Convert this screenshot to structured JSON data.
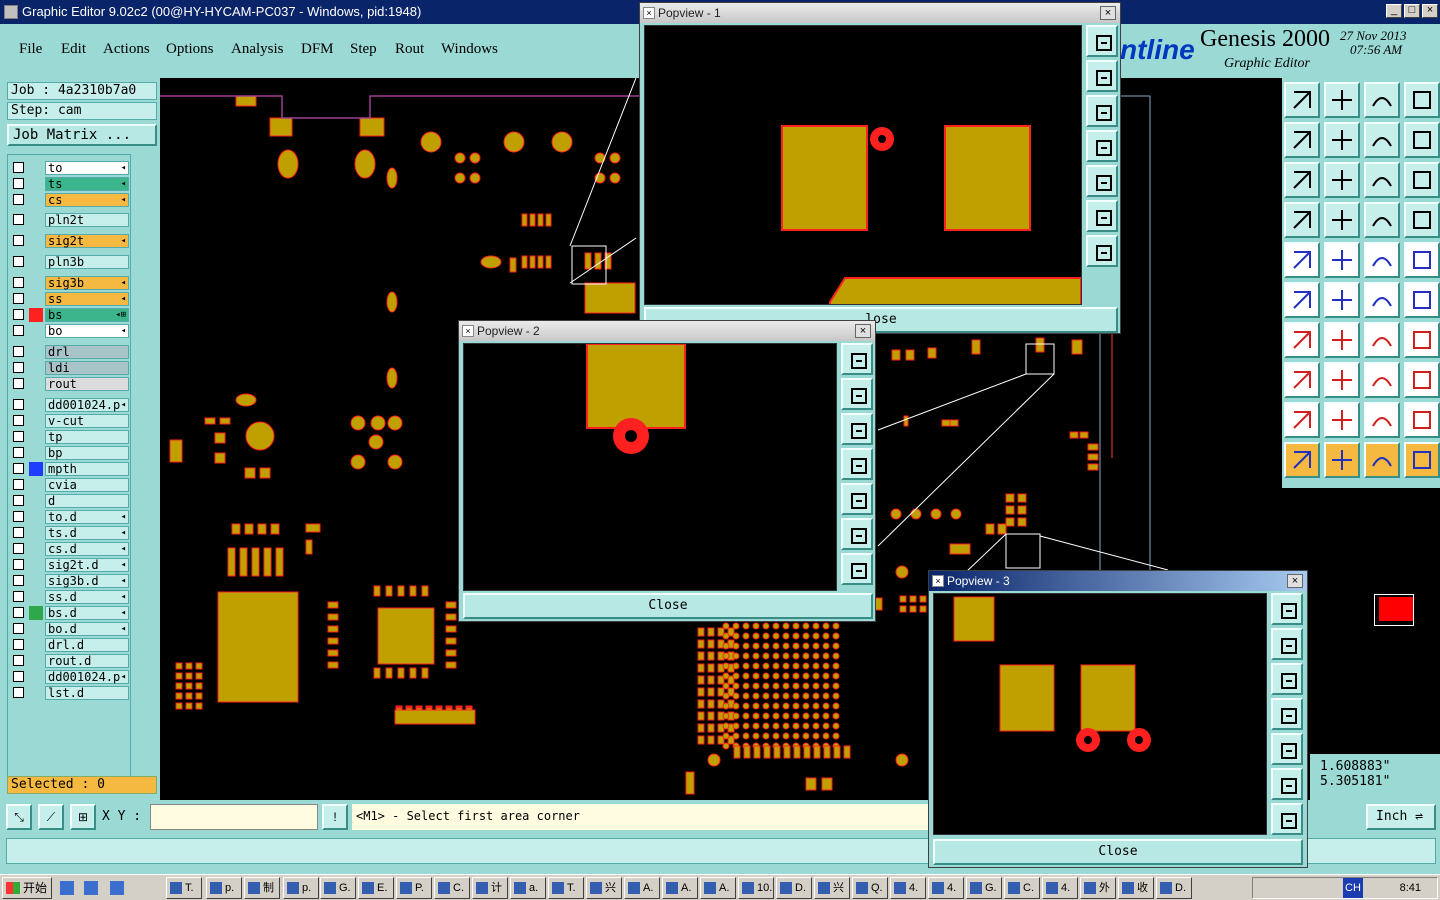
{
  "window": {
    "title": "Graphic Editor 9.02c2 (00@HY-HYCAM-PC037 - Windows, pid:1948)"
  },
  "menu": [
    "File",
    "Edit",
    "Actions",
    "Options",
    "Analysis",
    "DFM",
    "Step",
    "Rout",
    "Windows"
  ],
  "brand": {
    "frontline": "ntline",
    "product": "Genesis 2000",
    "subtitle": "Graphic Editor",
    "date": "27 Nov 2013",
    "time": "07:56 AM"
  },
  "job": {
    "job_label": "Job : 4a2310b7a0",
    "step_label": "Step: cam",
    "matrix_button": "Job Matrix ..."
  },
  "layers": [
    {
      "name": "to",
      "bg": "#ffffff",
      "swatch": "",
      "mark": "◂"
    },
    {
      "name": "ts",
      "bg": "#3cb58c",
      "swatch": "",
      "mark": "◂"
    },
    {
      "name": "cs",
      "bg": "#f5b942",
      "swatch": "",
      "mark": "◂"
    },
    {
      "name": "pln2t",
      "bg": "#c6efeb",
      "swatch": "",
      "mark": ""
    },
    {
      "name": "sig2t",
      "bg": "#f5b942",
      "swatch": "",
      "mark": "◂"
    },
    {
      "name": "pln3b",
      "bg": "#c6efeb",
      "swatch": "",
      "mark": ""
    },
    {
      "name": "sig3b",
      "bg": "#f5b942",
      "swatch": "",
      "mark": "◂"
    },
    {
      "name": "ss",
      "bg": "#f5b942",
      "swatch": "",
      "mark": "◂"
    },
    {
      "name": "bs",
      "bg": "#3cb58c",
      "swatch": "#ff2020",
      "mark": "◂⊞"
    },
    {
      "name": "bo",
      "bg": "#ffffff",
      "swatch": "",
      "mark": "◂"
    },
    {
      "name": "drl",
      "bg": "#a9c4c9",
      "swatch": "",
      "mark": ""
    },
    {
      "name": "ldi",
      "bg": "#a9c4c9",
      "swatch": "",
      "mark": ""
    },
    {
      "name": "rout",
      "bg": "#dcdcdc",
      "swatch": "",
      "mark": ""
    },
    {
      "name": "dd001024.p",
      "bg": "#c6efeb",
      "swatch": "",
      "mark": "◂"
    },
    {
      "name": "v-cut",
      "bg": "#c6efeb",
      "swatch": "",
      "mark": ""
    },
    {
      "name": "tp",
      "bg": "#c6efeb",
      "swatch": "",
      "mark": ""
    },
    {
      "name": "bp",
      "bg": "#c6efeb",
      "swatch": "",
      "mark": ""
    },
    {
      "name": "mpth",
      "bg": "#c6efeb",
      "swatch": "#1f3cff",
      "mark": ""
    },
    {
      "name": "cvia",
      "bg": "#c6efeb",
      "swatch": "",
      "mark": ""
    },
    {
      "name": "d",
      "bg": "#c6efeb",
      "swatch": "",
      "mark": ""
    },
    {
      "name": "to.d",
      "bg": "#c6efeb",
      "swatch": "",
      "mark": "◂"
    },
    {
      "name": "ts.d",
      "bg": "#c6efeb",
      "swatch": "",
      "mark": "◂"
    },
    {
      "name": "cs.d",
      "bg": "#c6efeb",
      "swatch": "",
      "mark": "◂"
    },
    {
      "name": "sig2t.d",
      "bg": "#c6efeb",
      "swatch": "",
      "mark": "◂"
    },
    {
      "name": "sig3b.d",
      "bg": "#c6efeb",
      "swatch": "",
      "mark": "◂"
    },
    {
      "name": "ss.d",
      "bg": "#c6efeb",
      "swatch": "",
      "mark": "◂"
    },
    {
      "name": "bs.d",
      "bg": "#c6efeb",
      "swatch": "#2ea84a",
      "mark": "◂"
    },
    {
      "name": "bo.d",
      "bg": "#c6efeb",
      "swatch": "",
      "mark": "◂"
    },
    {
      "name": "drl.d",
      "bg": "#c6efeb",
      "swatch": "",
      "mark": ""
    },
    {
      "name": "rout.d",
      "bg": "#c6efeb",
      "swatch": "",
      "mark": ""
    },
    {
      "name": "dd001024.p",
      "bg": "#c6efeb",
      "swatch": "",
      "mark": "◂"
    },
    {
      "name": "lst.d",
      "bg": "#c6efeb",
      "swatch": "",
      "mark": ""
    }
  ],
  "selected": "Selected : 0",
  "xy_label": "X Y :",
  "xy_value": "",
  "prompt": "<M1> - Select first area corner",
  "coords": {
    "x": "1.608883\"",
    "y": "5.305181\""
  },
  "units": "Inch",
  "popviews": [
    {
      "title": "Popview - 1",
      "close": "Close",
      "close_visible": "lose"
    },
    {
      "title": "Popview - 2",
      "close": "Close"
    },
    {
      "title": "Popview - 3",
      "close": "Close"
    }
  ],
  "colors": {
    "pad": "#c0a000",
    "pad_outline": "#ff2020",
    "canvas": "#000000",
    "panel": "#9ad9d4"
  },
  "taskbar": {
    "start": "开始",
    "tasks": [
      "T.",
      "p.",
      "制",
      "p.",
      "G.",
      "E.",
      "P.",
      "C.",
      "计",
      "a.",
      "T.",
      "兴",
      "A.",
      "A.",
      "A.",
      "10...",
      "D.",
      "兴",
      "Q.",
      "4.",
      "4.",
      "G.",
      "C.",
      "4.",
      "外",
      "收",
      "D."
    ],
    "clock": "8:41",
    "tray_label": "CH"
  }
}
